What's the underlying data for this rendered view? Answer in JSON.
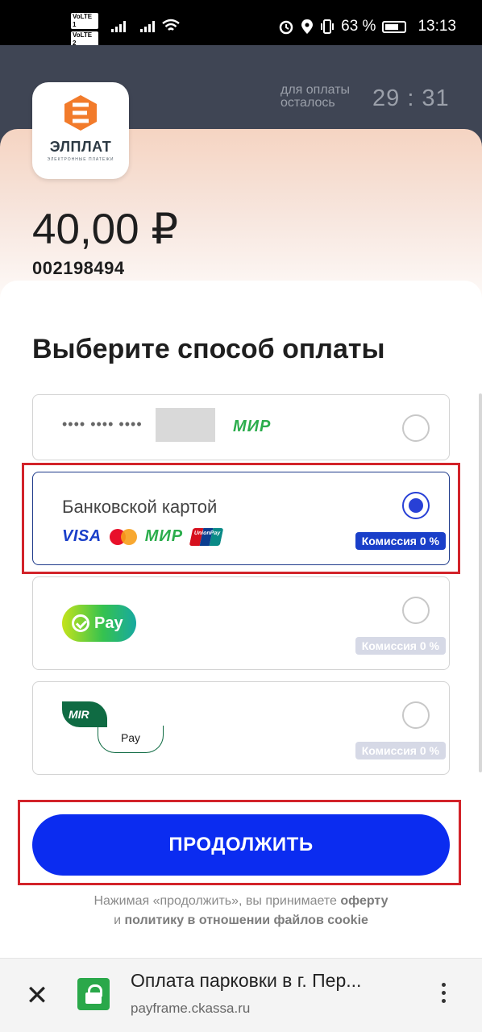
{
  "statusbar": {
    "volte1": "VoLTE 1",
    "volte2": "VoLTE 2",
    "battery_percent": "63 %",
    "time": "13:13"
  },
  "header": {
    "logo_text": "ЭЛПЛАТ",
    "logo_subtext": "ЭЛЕКТРОННЫЕ ПЛАТЕЖИ",
    "timer_label_line1": "для оплаты",
    "timer_label_line2": "осталось",
    "timer_value": "29 : 31",
    "amount": "40,00 ₽",
    "order_number": "002198494"
  },
  "payment": {
    "title": "Выберите способ оплаты",
    "saved_card": {
      "masked_number": "•••• •••• ••••",
      "brand": "МИР",
      "selected": false
    },
    "bank_card": {
      "label": "Банковской картой",
      "brands": [
        "VISA",
        "Mastercard",
        "МИР",
        "UnionPay"
      ],
      "visa_text": "VISA",
      "mir_text": "МИР",
      "unionpay_text": "UnionPay",
      "commission": "Комиссия 0 %",
      "selected": true
    },
    "sberpay": {
      "label": "Pay",
      "commission": "Комиссия 0 %",
      "selected": false
    },
    "mirpay": {
      "label_top": "MIR",
      "label_bottom": "Pay",
      "commission": "Комиссия 0 %",
      "selected": false
    }
  },
  "continue_button": "ПРОДОЛЖИТЬ",
  "consent": {
    "line1_prefix": "Нажимая «продолжить», вы принимаете ",
    "line1_link": "оферту",
    "line2_prefix": "и ",
    "line2_link": "политику в отношении файлов cookie"
  },
  "browser": {
    "page_title": "Оплата парковки в г. Пер...",
    "url": "payframe.ckassa.ru"
  },
  "colors": {
    "accent": "#0b2cf0",
    "highlight": "#d2232a",
    "header_dark": "#3f4554",
    "mir_green": "#2bad4c"
  }
}
